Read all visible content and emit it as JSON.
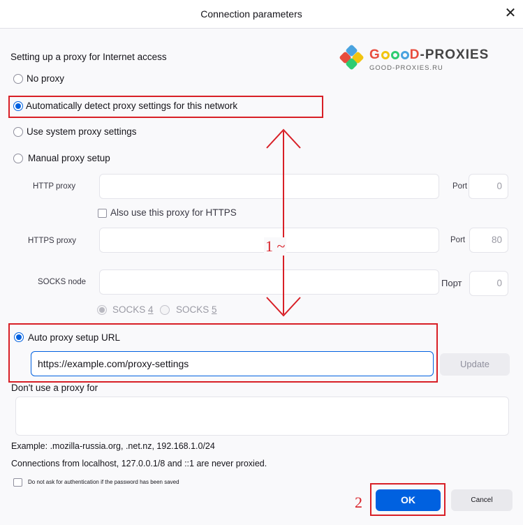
{
  "window": {
    "title": "Connection parameters",
    "close_glyph": "✕"
  },
  "logo": {
    "brand_g": "G",
    "brand_d": "D",
    "brand_rest": "-PROXIES",
    "domain": "GOOD-PROXIES.RU"
  },
  "proxy": {
    "heading": "Setting up a proxy for Internet access",
    "options": {
      "no_proxy": "No proxy",
      "auto_detect": "Automatically detect proxy settings for this network",
      "system": "Use system proxy settings",
      "manual": "Manual proxy setup",
      "auto_url": "Auto proxy setup URL"
    },
    "selected": "auto_detect",
    "http": {
      "label": "HTTP proxy",
      "value": "",
      "port_label": "Port",
      "port": "0"
    },
    "also_https": "Also use this proxy for HTTPS",
    "https": {
      "label": "HTTPS proxy",
      "value": "",
      "port_label": "Port",
      "port": "80"
    },
    "socks": {
      "label": "SOCKS node",
      "value": "",
      "port_label": "Порт",
      "port": "0",
      "v4_label": "SOCKS ",
      "v4_key": "4",
      "v5_label": "SOCKS ",
      "v5_key": "5",
      "selected": "v4"
    },
    "auto_url_value": "https://example.com/proxy-settings",
    "update_button": "Update",
    "no_proxy_for": {
      "label": "Don't use a proxy for",
      "value": ""
    },
    "example_text": "Example: .mozilla-russia.org, .net.nz, 192.168.1.0/24",
    "localhost_text": "Connections from localhost, 127.0.0.1/8 and ::1 are never proxied.",
    "no_auth_prompt": "Do not ask for authentication if the password has been saved"
  },
  "annotations": {
    "arrow_label": "1 ~",
    "ok_label_num": "2",
    "accent_red": "#d81f26"
  },
  "buttons": {
    "ok": "OK",
    "cancel": "Cancel"
  },
  "colors": {
    "accent_blue": "#0061e0",
    "red": "#d81f26"
  }
}
